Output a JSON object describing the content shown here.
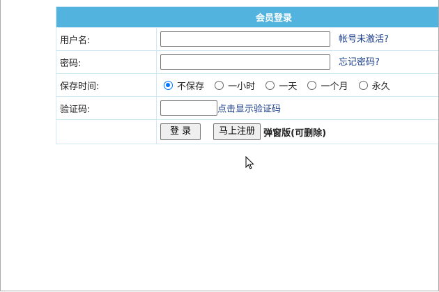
{
  "title": "会员登录",
  "username": {
    "label": "用户名:",
    "value": "",
    "link": "帐号未激活?"
  },
  "password": {
    "label": "密码:",
    "value": "",
    "link": "忘记密码?"
  },
  "save_time": {
    "label": "保存时间:",
    "options": [
      "不保存",
      "一小时",
      "一天",
      "一个月",
      "永久"
    ],
    "selected": "不保存"
  },
  "captcha": {
    "label": "验证码:",
    "value": "",
    "link": "点击显示验证码"
  },
  "actions": {
    "login": "登 录",
    "register": "马上注册",
    "note": "弹窗版(可删除)"
  },
  "colors": {
    "header": "#52b4de",
    "link": "#1a3d8a"
  }
}
